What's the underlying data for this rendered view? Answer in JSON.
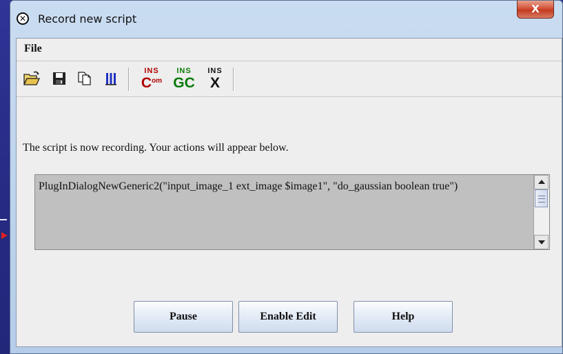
{
  "window": {
    "title": "Record new script",
    "close_label": "X"
  },
  "menu": {
    "file_label": "File"
  },
  "toolbar": {
    "buttons": [
      {
        "icon": "open-folder-icon"
      },
      {
        "icon": "save-disk-icon"
      },
      {
        "icon": "copy-icon"
      },
      {
        "icon": "columns-icon"
      }
    ],
    "insert_buttons": [
      {
        "top": "INS",
        "bottom": "C",
        "bottom_suffix": "om",
        "color": "#b00000"
      },
      {
        "top": "INS",
        "bottom": "GC",
        "bottom_suffix": "",
        "color": "#0a7a0a"
      },
      {
        "top": "INS",
        "bottom": "X",
        "bottom_suffix": "",
        "color": "#111111"
      }
    ]
  },
  "status_message": "The script is now recording.  Your actions will appear below.",
  "script_text": "PlugInDialogNewGeneric2(\"input_image_1 ext_image $image1\", \"do_gaussian boolean true\")",
  "buttons": {
    "pause": "Pause",
    "enable_edit": "Enable Edit",
    "help": "Help"
  }
}
